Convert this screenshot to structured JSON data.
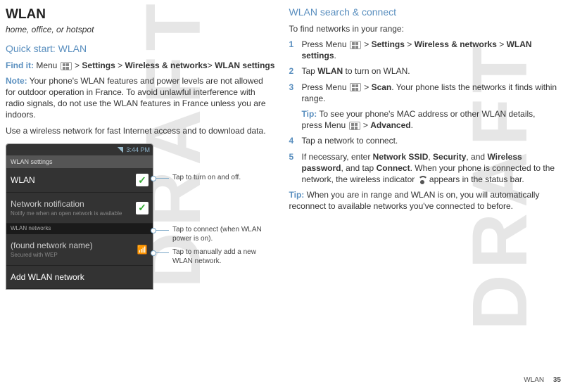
{
  "watermark": "DRAFT",
  "left": {
    "title": "WLAN",
    "subtitle": "home, office, or hotspot",
    "quickstart_heading": "Quick start: WLAN",
    "findit_label": "Find it:",
    "findit_text_1": "Menu",
    "findit_sep": ">",
    "findit_settings": "Settings",
    "findit_wireless": "Wireless & networks",
    "findit_wlan": "WLAN settings",
    "note_label": "Note:",
    "note_text": "Your phone's WLAN features and power levels are not allowed for outdoor operation in France. To avoid unlawful interference with radio signals, do not use the WLAN features in France unless you are indoors.",
    "body_text": "Use a wireless network for fast Internet access and to download data."
  },
  "phone": {
    "time": "3:44 PM",
    "titlebar": "WLAN settings",
    "wlan_row": "WLAN",
    "notif_title": "Network notification",
    "notif_sub": "Notify me when an open network is available",
    "networks_hdr": "WLAN networks",
    "found_name": "(found network name)",
    "found_sub": "Secured with WEP",
    "add_row": "Add WLAN network"
  },
  "callouts": {
    "c1": "Tap to turn on and off.",
    "c2": "Tap to connect (when WLAN power is on).",
    "c3": "Tap to manually add a new WLAN network."
  },
  "right": {
    "heading": "WLAN search & connect",
    "intro": "To find networks in your range:",
    "s1a": "Press Menu",
    "s1b": "Settings",
    "s1c": "Wireless & networks",
    "s1d": "WLAN settings",
    "s2a": "Tap",
    "s2b": "WLAN",
    "s2c": "to turn on WLAN.",
    "s3a": "Press Menu",
    "s3b": "Scan",
    "s3c": ". Your phone lists the networks it finds within range.",
    "tip_label": "Tip:",
    "tip_text_a": "To see your phone's MAC address or other WLAN details, press Menu",
    "tip_text_b": "Advanced",
    "s4": "Tap a network to connect.",
    "s5a": "If necessary, enter",
    "s5_ssid": "Network SSID",
    "s5_sec": "Security",
    "s5_and": ", and",
    "s5_pwd": "Wireless password",
    "s5b": ", and tap",
    "s5_connect": "Connect",
    "s5c": ". When your phone is connected to the network, the wireless indicator",
    "s5d": "appears in the status bar.",
    "tip2_label": "Tip:",
    "tip2_text": "When you are in range and WLAN is on, you will automatically reconnect to available networks you've connected to before."
  },
  "footer": {
    "section": "WLAN",
    "page": "35"
  }
}
